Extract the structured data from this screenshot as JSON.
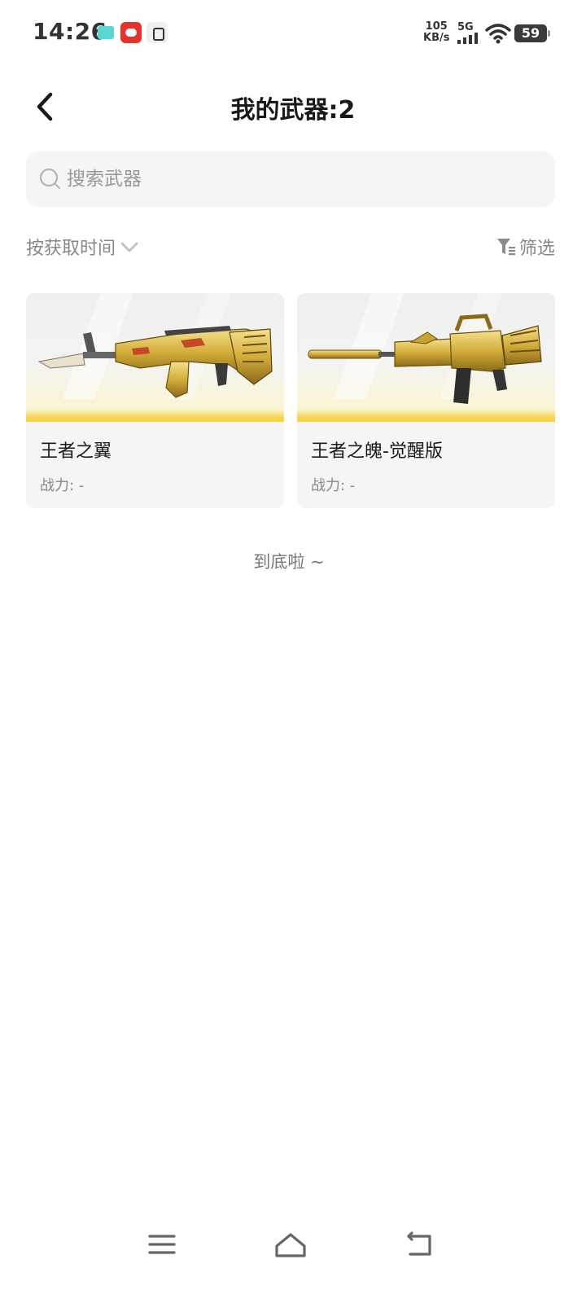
{
  "status_bar": {
    "time": "14:26",
    "net_speed_value": "105",
    "net_speed_unit": "KB/s",
    "network_type": "5G",
    "battery": "59"
  },
  "header": {
    "title": "我的武器:2"
  },
  "search": {
    "placeholder": "搜索武器",
    "value": ""
  },
  "toolbar": {
    "sort_label": "按获取时间",
    "filter_label": "筛选"
  },
  "weapons": [
    {
      "name": "王者之翼",
      "power": "战力: -"
    },
    {
      "name": "王者之魄-觉醒版",
      "power": "战力: -"
    }
  ],
  "end_message": "到底啦 ~",
  "colors": {
    "accent_yellow": "#f5d24a",
    "card_bg": "#f5f5f5",
    "gold": "#d4ad3a"
  }
}
